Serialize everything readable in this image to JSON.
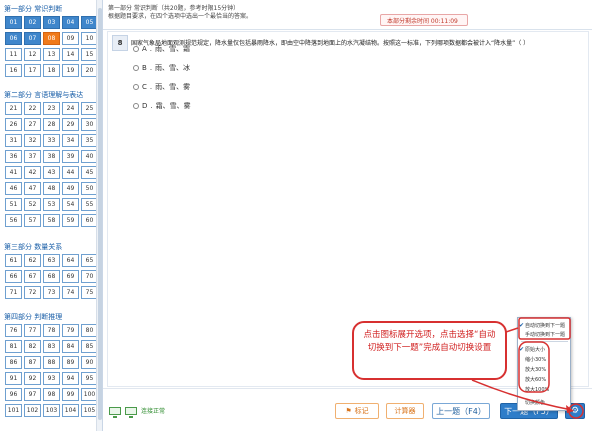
{
  "sidebar": {
    "sections": [
      {
        "title": "第一部分  常识判断",
        "questions": [
          "01",
          "02",
          "03",
          "04",
          "05",
          "06",
          "07",
          "08",
          "09",
          "10",
          "11",
          "12",
          "13",
          "14",
          "15",
          "16",
          "17",
          "18",
          "19",
          "20"
        ],
        "done": [
          "01",
          "02",
          "03",
          "04",
          "05",
          "06",
          "07"
        ],
        "current": "08"
      },
      {
        "title": "第二部分  言语理解与表达",
        "questions": [
          "21",
          "22",
          "23",
          "24",
          "25",
          "26",
          "27",
          "28",
          "29",
          "30",
          "31",
          "32",
          "33",
          "34",
          "35",
          "36",
          "37",
          "38",
          "39",
          "40",
          "41",
          "42",
          "43",
          "44",
          "45",
          "46",
          "47",
          "48",
          "49",
          "50",
          "51",
          "52",
          "53",
          "54",
          "55",
          "56",
          "57",
          "58",
          "59",
          "60"
        ]
      },
      {
        "title": "第三部分  数量关系",
        "questions": [
          "61",
          "62",
          "63",
          "64",
          "65",
          "66",
          "67",
          "68",
          "69",
          "70",
          "71",
          "72",
          "73",
          "74",
          "75"
        ]
      },
      {
        "title": "第四部分  判断推理",
        "questions": [
          "76",
          "77",
          "78",
          "79",
          "80",
          "81",
          "82",
          "83",
          "84",
          "85",
          "86",
          "87",
          "88",
          "89",
          "90",
          "91",
          "92",
          "93",
          "94",
          "95",
          "96",
          "97",
          "98",
          "99",
          "100",
          "101",
          "102",
          "103",
          "104",
          "105"
        ]
      }
    ]
  },
  "header": {
    "line1": "第一部分   常识判断（共20题，参考时限15分钟）",
    "line2": "根据题目要求，在四个选项中选出一个最恰当的答案。",
    "timer": "本部分剩余时间  00:11:09"
  },
  "question": {
    "number": "8",
    "stem": "国家气象局地面观测规范规定，降水量仅包括暴雨降水，即由空中降落到地面上的水汽凝结物。按照这一标准，下列哪项数据都会被计入“降水量”（  ）",
    "options": [
      {
        "letter": "A",
        "text": "雨、雪、霜"
      },
      {
        "letter": "B",
        "text": "雨、雪、冰"
      },
      {
        "letter": "C",
        "text": "雨、雪、雾"
      },
      {
        "letter": "D",
        "text": "霜、雪、雾"
      }
    ]
  },
  "footer": {
    "network_status": "连接正常",
    "mark_label": "标记",
    "calc_label": "计算器",
    "prev_label": "上一题（F4）",
    "next_label": "下一题（F5）"
  },
  "popup": {
    "auto_next": "自动切换到下一题",
    "manual_next": "手动切换到下一题",
    "zoom_options": [
      "原始大小",
      "缩小30%",
      "放大30%",
      "放大60%",
      "放大100%"
    ],
    "extra": "切换颜色"
  },
  "annotation": "点击图标展开选项，点击选择“自动切换到下一题”完成自动切换设置",
  "colors": {
    "accent": "#2f7dc9",
    "current": "#f07a1a",
    "annotation": "#d73030"
  }
}
